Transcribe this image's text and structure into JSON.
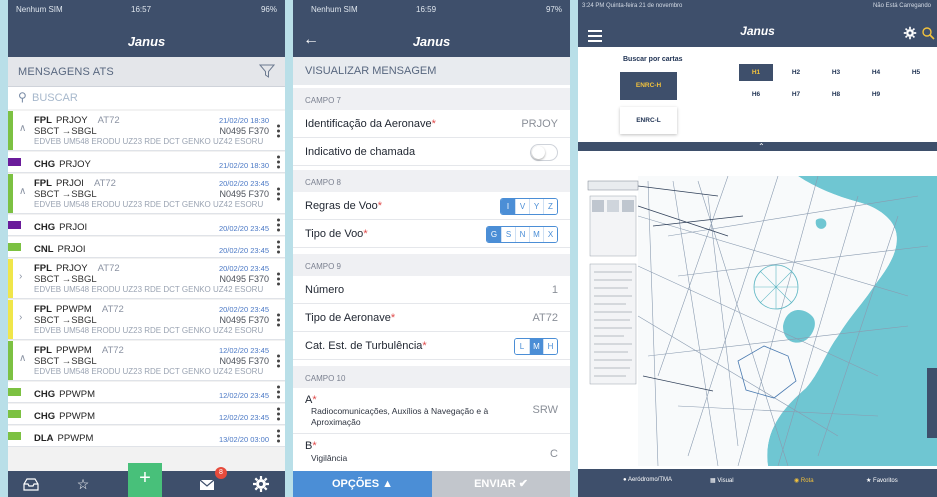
{
  "left": {
    "status": {
      "carrier": "Nenhum SIM",
      "time": "16:57",
      "battery": "96%"
    },
    "title": "Janus",
    "section": "MENSAGENS ATS",
    "search_placeholder": "BUSCAR",
    "messages": [
      {
        "type": "FPL",
        "ident": "PRJOY",
        "aircraft": "AT72",
        "route_short": "SBCT →SBGL",
        "route": "EDVEB UM548 ERODU UZ23 RDE DCT GENKO UZ42 ESORU",
        "time": "21/02/20 18:30",
        "code": "N0495 F370",
        "color": "#7cc142",
        "kind": "full",
        "chev": "expanded"
      },
      {
        "type": "CHG",
        "ident": "PRJOY",
        "time": "21/02/20 18:30",
        "color": "#6a1b9a",
        "kind": "single"
      },
      {
        "type": "FPL",
        "ident": "PRJOI",
        "aircraft": "AT72",
        "route_short": "SBCT →SBGL",
        "route": "EDVEB UM548 ERODU UZ23 RDE DCT GENKO UZ42 ESORU",
        "time": "20/02/20 23:45",
        "code": "N0495 F370",
        "color": "#7cc142",
        "kind": "full",
        "chev": "expanded"
      },
      {
        "type": "CHG",
        "ident": "PRJOI",
        "time": "20/02/20 23:45",
        "color": "#6a1b9a",
        "kind": "single"
      },
      {
        "type": "CNL",
        "ident": "PRJOI",
        "time": "20/02/20 23:45",
        "color": "#7cc142",
        "kind": "single"
      },
      {
        "type": "FPL",
        "ident": "PRJOY",
        "aircraft": "AT72",
        "route_short": "SBCT →SBGL",
        "route": "EDVEB UM548 ERODU UZ23 RDE DCT GENKO UZ42 ESORU",
        "time": "20/02/20 23:45",
        "code": "N0495 F370",
        "color": "#f0e64a",
        "kind": "full",
        "chev": "collapsed"
      },
      {
        "type": "FPL",
        "ident": "PPWPM",
        "aircraft": "AT72",
        "route_short": "SBCT →SBGL",
        "route": "EDVEB UM548 ERODU UZ23 RDE DCT GENKO UZ42 ESORU",
        "time": "20/02/20 23:45",
        "code": "N0495 F370",
        "color": "#f0e64a",
        "kind": "full",
        "chev": "collapsed"
      },
      {
        "type": "FPL",
        "ident": "PPWPM",
        "aircraft": "AT72",
        "route_short": "SBCT →SBGL",
        "route": "EDVEB UM548 ERODU UZ23 RDE DCT GENKO UZ42 ESORU",
        "time": "12/02/20 23:45",
        "code": "N0495 F370",
        "color": "#7cc142",
        "kind": "full",
        "chev": "expanded"
      },
      {
        "type": "CHG",
        "ident": "PPWPM",
        "time": "12/02/20 23:45",
        "color": "#7cc142",
        "kind": "single"
      },
      {
        "type": "CHG",
        "ident": "PPWPM",
        "time": "12/02/20 23:45",
        "color": "#7cc142",
        "kind": "single"
      },
      {
        "type": "DLA",
        "ident": "PPWPM",
        "time": "13/02/20 03:00",
        "color": "#7cc142",
        "kind": "single"
      }
    ],
    "tabbar": {
      "badge": "8"
    }
  },
  "middle": {
    "status": {
      "carrier": "Nenhum SIM",
      "time": "16:59",
      "battery": "97%"
    },
    "title": "Janus",
    "subtitle": "VISUALIZAR MENSAGEM",
    "campo7": "CAMPO 7",
    "ident_label": "Identificação da Aeronave",
    "ident_value": "PRJOY",
    "callsign_label": "Indicativo de chamada",
    "campo8": "CAMPO 8",
    "regras_label": "Regras de Voo",
    "regras_options": [
      "I",
      "V",
      "Y",
      "Z"
    ],
    "tipo_voo_label": "Tipo de Voo",
    "tipo_voo_options": [
      "G",
      "S",
      "N",
      "M",
      "X"
    ],
    "campo9": "CAMPO 9",
    "numero_label": "Número",
    "numero_value": "1",
    "tipo_aeronave_label": "Tipo de Aeronave",
    "tipo_aeronave_value": "AT72",
    "turb_label": "Cat. Est. de Turbulência",
    "turb_options": [
      "L",
      "M",
      "H"
    ],
    "campo10": "CAMPO 10",
    "a_label": "A",
    "a_desc": "Radiocomunicações, Auxílios à Navegação e à Aproximação",
    "a_value": "SRW",
    "b_label": "B",
    "b_desc": "Vigilância",
    "b_value": "C",
    "opcoes": "OPÇÕES",
    "enviar": "ENVIAR"
  },
  "right": {
    "status_left": "3:24 PM  Quinta-feira 21 de novembro",
    "status_right": "Não Está Carregando",
    "title": "Janus",
    "buscar": "Buscar por cartas",
    "enrc_h": "ENRC-H",
    "enrc_l": "ENRC-L",
    "h_buttons": [
      "H1",
      "H2",
      "H3",
      "H4",
      "H5",
      "H6",
      "H7",
      "H8",
      "H9"
    ],
    "tabs": [
      "Aeródromo/TMA",
      "Visual",
      "Rota",
      "Favoritos"
    ]
  }
}
